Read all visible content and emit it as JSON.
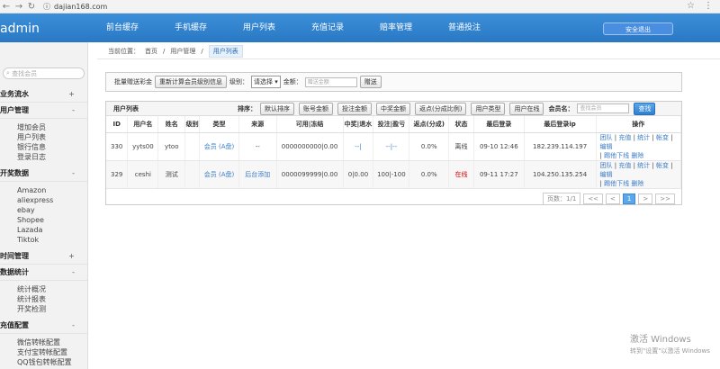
{
  "browser": {
    "back": "←",
    "forward": "→",
    "reload": "↻",
    "url": "dajian168.com"
  },
  "brand": "admin",
  "topnav": [
    "前台缓存",
    "手机缓存",
    "用户列表",
    "充值记录",
    "赔率管理",
    "普通投注"
  ],
  "safe_exit": "安全退出",
  "sidebar": {
    "search_placeholder": "查找会员",
    "groups": [
      {
        "label": "业务流水",
        "toggle": "+",
        "items": []
      },
      {
        "label": "用户管理",
        "toggle": "-",
        "items": [
          "增加会员",
          "用户列表",
          "银行信息",
          "登录日志"
        ]
      },
      {
        "label": "开奖数据",
        "toggle": "-",
        "items": [
          "Amazon",
          "aliexpress",
          "ebay",
          "Shopee",
          "Lazada",
          "Tiktok"
        ]
      },
      {
        "label": "时间管理",
        "toggle": "+",
        "items": []
      },
      {
        "label": "数据统计",
        "toggle": "-",
        "items": [
          "统计概况",
          "统计报表",
          "开奖检测"
        ]
      },
      {
        "label": "充值配置",
        "toggle": "-",
        "items": [
          "微信转帐配置",
          "支付宝转帐配置",
          "QQ钱包转帐配置"
        ]
      }
    ]
  },
  "breadcrumb": {
    "prefix": "当前位置：",
    "home": "首页",
    "sep": "/",
    "section": "用户管理",
    "current": "用户列表"
  },
  "filter": {
    "label": "批量赠送彩金",
    "refresh_btn": "重新计算会员级别信息",
    "level_label": "级别：",
    "level_value": "请选择",
    "amount_label": "金额：",
    "amount_placeholder": "赠送金额",
    "submit": "赠送"
  },
  "list": {
    "title": "用户列表",
    "sort_label": "排序：",
    "sort_buttons": [
      "默认排序",
      "账号金额",
      "投注金额",
      "中奖金额",
      "返点(分成比例)",
      "用户类型",
      "用户在线"
    ],
    "member_label": "会员名：",
    "member_placeholder": "查找会员",
    "search": "查找",
    "columns": [
      "ID",
      "用户名",
      "姓名",
      "级别",
      "类型",
      "来源",
      "可用|冻结",
      "中奖|退水",
      "投注|盈亏",
      "返点(分成)",
      "状态",
      "最后登录",
      "最后登录ip",
      "操作"
    ],
    "rows": [
      {
        "id": "330",
        "username": "yyts00",
        "name": "ytoo",
        "level": "",
        "type": "会员 (A盘)",
        "source": "--",
        "balance": "0000000000|0.00",
        "win": "--|",
        "bet": "--|--",
        "rebate": "0.0%",
        "status": "离线",
        "last_login": "09-10 12:46",
        "ip": "182.239.114.197",
        "ops": [
          "团队",
          "充值",
          "统计",
          "帐变",
          "编辑",
          "踢他下线",
          "删除"
        ]
      },
      {
        "id": "329",
        "username": "ceshi",
        "name": "测试",
        "level": "",
        "type": "会员 (A盘)",
        "source": "后台添加",
        "balance": "0000099999|0.00",
        "win": "0|0.00",
        "bet": "100|-100",
        "rebate": "0.0%",
        "status": "在线",
        "last_login": "09-11 17:27",
        "ip": "104.250.135.254",
        "ops": [
          "团队",
          "充值",
          "统计",
          "帐变",
          "编辑",
          "踢他下线",
          "删除"
        ]
      }
    ],
    "pager": {
      "pages_label": "页数：1/1",
      "first": "<<",
      "prev": "<",
      "current": "1",
      "next": ">",
      "last": ">>"
    }
  },
  "watermark": {
    "line1": "激活 Windows",
    "line2": "转到\"设置\"以激活 Windows"
  }
}
